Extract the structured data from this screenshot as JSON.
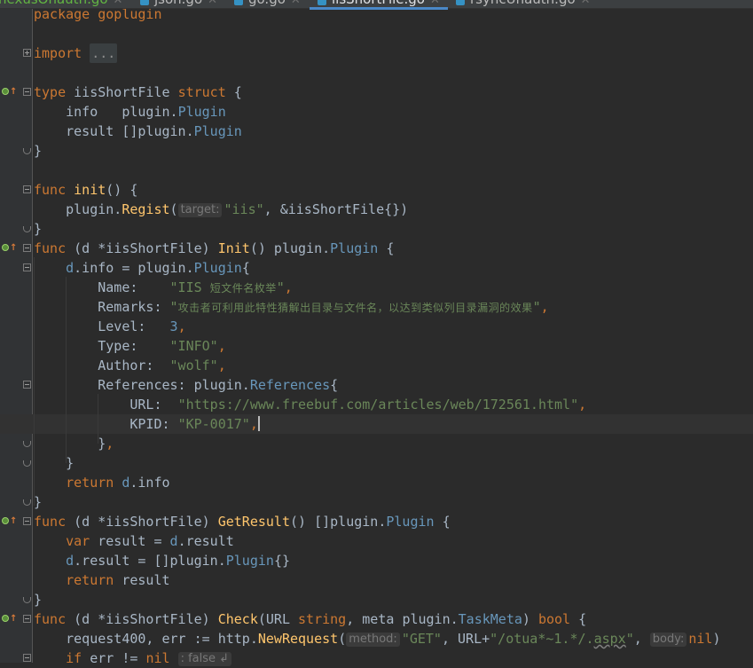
{
  "tabs": [
    {
      "label": "nexusOnauth.go",
      "state": "modified"
    },
    {
      "label": "json.go",
      "state": "normal"
    },
    {
      "label": "go.go",
      "state": "normal"
    },
    {
      "label": "iisShortFile.go",
      "state": "active"
    },
    {
      "label": "rsyncUnauth.go",
      "state": "normal"
    }
  ],
  "code": {
    "l0": "package goplugin",
    "l2_import": "import",
    "l2_folded": "...",
    "l4_type": "type",
    "l4_name": "iisShortFile",
    "l4_struct": "struct",
    "l4_brace": "{",
    "l5_field": "info",
    "l5_pkg": "plugin.",
    "l5_type": "Plugin",
    "l6_field": "result",
    "l6_br": "[]",
    "l6_pkg": "plugin.",
    "l6_type": "Plugin",
    "l7": "}",
    "l9_func": "func",
    "l9_name": "init",
    "l9_rest": "() {",
    "l10_pkg": "plugin.",
    "l10_fn": "Regist",
    "l10_paren": "(",
    "l10_hint": "target:",
    "l10_str": "\"iis\"",
    "l10_rest": ", &iisShortFile{})",
    "l11": "}",
    "l12_func": "func",
    "l12_recv": " (d *iisShortFile) ",
    "l12_name": "Init",
    "l12_mid": "() plugin.",
    "l12_type": "Plugin",
    "l12_end": " {",
    "l13_d": "d",
    "l13_field": ".info",
    "l13_mid": " = plugin.",
    "l13_type": "Plugin",
    "l13_end": "{",
    "l14_key": "Name:    ",
    "l14_q1": "\"IIS ",
    "l14_cjk": "短文件名枚举",
    "l14_q2": "\"",
    "l14_comma": ",",
    "l15_key": "Remarks: ",
    "l15_q1": "\"",
    "l15_cjk": "攻击者可利用此特性猜解出目录与文件名，以达到类似列目录漏洞的效果",
    "l15_q2": "\"",
    "l15_comma": ",",
    "l16_key": "Level:   ",
    "l16_num": "3",
    "l16_comma": ",",
    "l17_key": "Type:    ",
    "l17_str": "\"INFO\"",
    "l17_comma": ",",
    "l18_key": "Author:  ",
    "l18_str": "\"wolf\"",
    "l18_comma": ",",
    "l19_key": "References: ",
    "l19_pkg": "plugin.",
    "l19_type": "References",
    "l19_end": "{",
    "l20_key": "URL:  ",
    "l20_str": "\"https://www.freebuf.com/articles/web/172561.html\"",
    "l20_comma": ",",
    "l21_key": "KPID: ",
    "l21_str": "\"KP-0017\"",
    "l21_comma": ",",
    "l22_close": "}",
    "l22_comma": ",",
    "l23": "}",
    "l24_kw": "return",
    "l24_d": " d",
    "l24_field": ".info",
    "l25": "}",
    "l26_func": "func",
    "l26_recv": " (d *iisShortFile) ",
    "l26_name": "GetResult",
    "l26_mid": "() []plugin.",
    "l26_type": "Plugin",
    "l26_end": " {",
    "l27_kw": "var",
    "l27_mid": " result = ",
    "l27_d": "d",
    "l27_field": ".result",
    "l28_d": "d",
    "l28_field": ".result",
    "l28_mid": " = []plugin.",
    "l28_type": "Plugin",
    "l28_end": "{}",
    "l29_kw": "return",
    "l29_rest": " result",
    "l30": "}",
    "l31_func": "func",
    "l31_recv": " (d *iisShortFile) ",
    "l31_name": "Check",
    "l31_a": "(URL ",
    "l31_string": "string",
    "l31_b": ", meta ",
    "l31_pkg": "plugin.",
    "l31_type": "TaskMeta",
    "l31_c": ") ",
    "l31_bool": "bool",
    "l31_end": " {",
    "l32_a": "request400, err := ",
    "l32_pkg": "http.",
    "l32_fn": "NewRequest",
    "l32_paren": "(",
    "l32_hint_method": "method:",
    "l32_get": "\"GET\"",
    "l32_b": ", URL+",
    "l32_path_a": "\"/otua*~1.*/.",
    "l32_path_b": "aspx",
    "l32_path_c": "\"",
    "l32_c": ", ",
    "l32_hint_body": "body:",
    "l32_nil": "nil",
    "l32_end": ")",
    "l33_kw": "if",
    "l33_a": " err != ",
    "l33_nil": "nil",
    "l33_hint": ": false ↲"
  },
  "colors": {
    "background": "#2b2b2b",
    "keyword": "#cc7832",
    "function": "#ffc66d",
    "type": "#6897bb",
    "string": "#6a8759",
    "field": "#9876aa"
  }
}
